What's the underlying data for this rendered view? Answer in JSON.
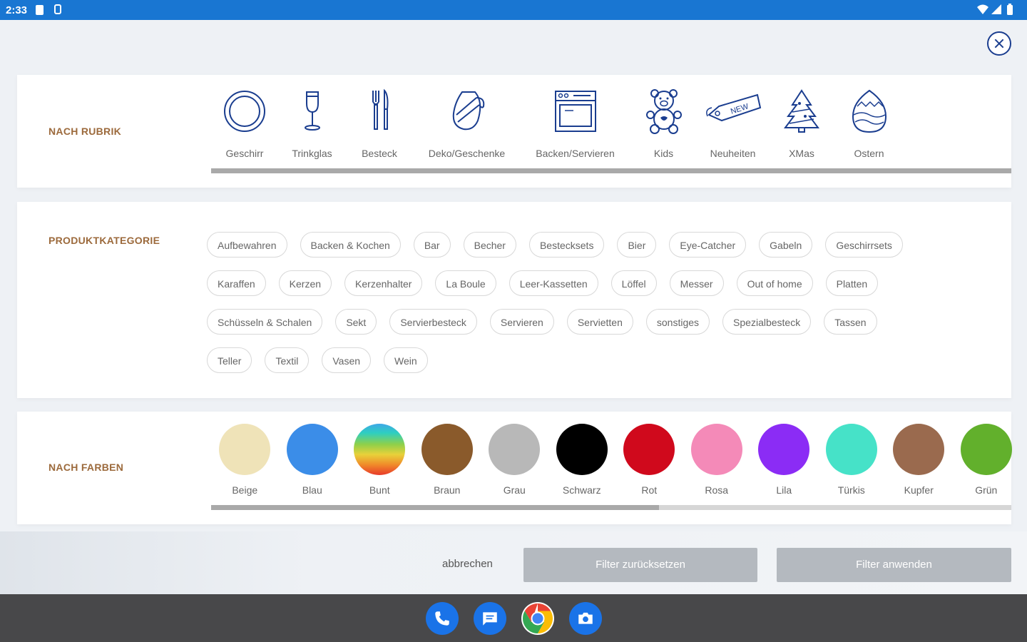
{
  "status_bar": {
    "time": "2:33"
  },
  "rubrik": {
    "title": "NACH RUBRIK",
    "items": [
      {
        "label": "Geschirr",
        "icon": "plate-icon"
      },
      {
        "label": "Trinkglas",
        "icon": "wine-glass-icon"
      },
      {
        "label": "Besteck",
        "icon": "cutlery-icon"
      },
      {
        "label": "Deko/Geschenke",
        "icon": "gift-vase-icon"
      },
      {
        "label": "Backen/Servieren",
        "icon": "oven-icon"
      },
      {
        "label": "Kids",
        "icon": "teddy-bear-icon"
      },
      {
        "label": "Neuheiten",
        "icon": "new-tag-icon",
        "tag_text": "NEW"
      },
      {
        "label": "XMas",
        "icon": "christmas-tree-icon"
      },
      {
        "label": "Ostern",
        "icon": "easter-egg-icon"
      }
    ],
    "scroll_fraction": 1.0
  },
  "kategorie": {
    "title": "PRODUKTKATEGORIE",
    "rows": [
      [
        "Aufbewahren",
        "Backen & Kochen",
        "Bar",
        "Becher",
        "Bestecksets",
        "Bier",
        "Eye-Catcher",
        "Gabeln",
        "Geschirrsets"
      ],
      [
        "Karaffen",
        "Kerzen",
        "Kerzenhalter",
        "La Boule",
        "Leer-Kassetten",
        "Löffel",
        "Messer",
        "Out of home",
        "Platten"
      ],
      [
        "Schüsseln & Schalen",
        "Sekt",
        "Servierbesteck",
        "Servieren",
        "Servietten",
        "sonstiges",
        "Spezialbesteck",
        "Tassen"
      ],
      [
        "Teller",
        "Textil",
        "Vasen",
        "Wein"
      ]
    ]
  },
  "farben": {
    "title": "NACH FARBEN",
    "items": [
      {
        "label": "Beige",
        "color": "#efe3b8"
      },
      {
        "label": "Blau",
        "color": "#3b8de8"
      },
      {
        "label": "Bunt",
        "color": "gradient-multicolor"
      },
      {
        "label": "Braun",
        "color": "#8a5a2b"
      },
      {
        "label": "Grau",
        "color": "#b8b8b8"
      },
      {
        "label": "Schwarz",
        "color": "#000000"
      },
      {
        "label": "Rot",
        "color": "#d0091c"
      },
      {
        "label": "Rosa",
        "color": "#f48ab8"
      },
      {
        "label": "Lila",
        "color": "#8b2cf5"
      },
      {
        "label": "Türkis",
        "color": "#46e2c8"
      },
      {
        "label": "Kupfer",
        "color": "#9a6a4e"
      },
      {
        "label": "Grün",
        "color": "#62b02c"
      }
    ],
    "scroll_fraction": 0.56
  },
  "footer": {
    "cancel_label": "abbrechen",
    "reset_label": "Filter zurücksetzen",
    "apply_label": "Filter anwenden"
  },
  "dock": {
    "apps": [
      "phone-icon",
      "messages-icon",
      "chrome-icon",
      "camera-icon"
    ]
  },
  "colors": {
    "accent_blue": "#1a3d8f",
    "section_title": "#9c6a3c",
    "status_bar": "#1976d2",
    "button_disabled": "#b4b9bf"
  }
}
